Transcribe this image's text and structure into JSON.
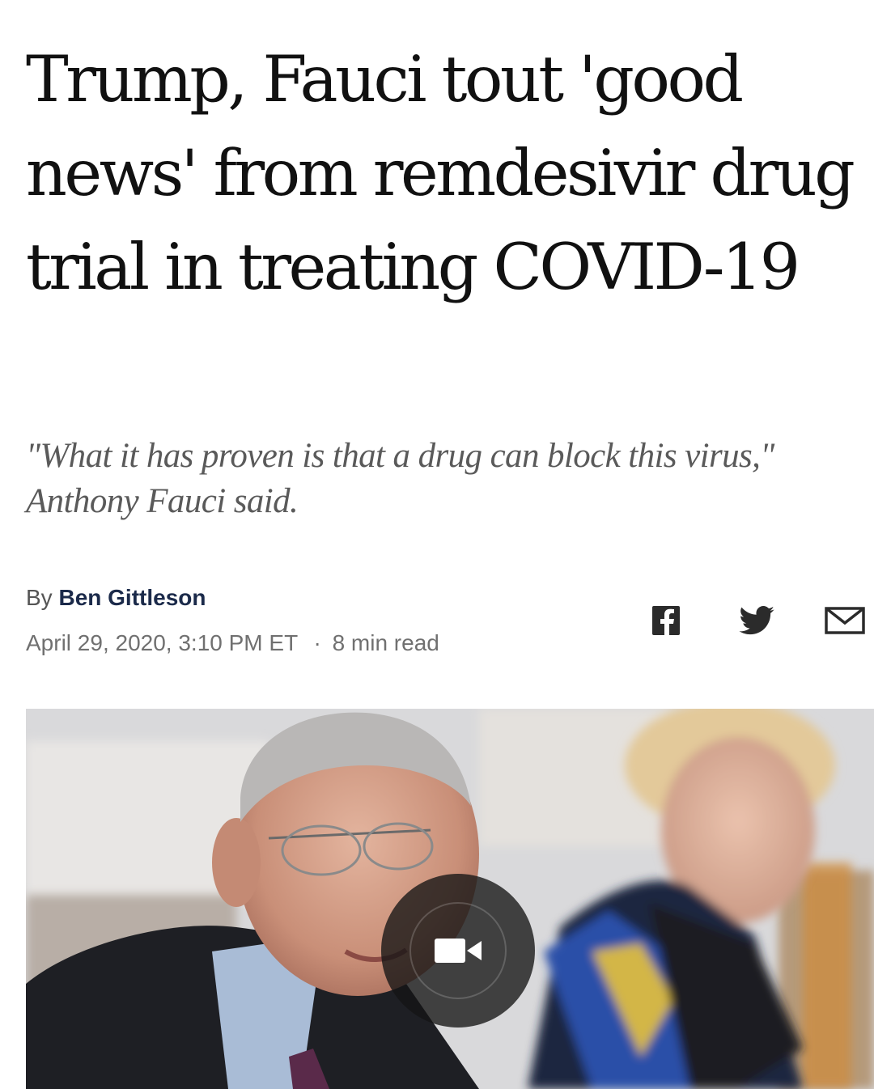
{
  "article": {
    "headline": "Trump, Fauci tout 'good news' from remdesivir drug trial in treating COVID-19",
    "dek": "\"What it has proven is that a drug can block this virus,\" Anthony Fauci said.",
    "byline": {
      "prefix": "By",
      "author": "Ben Gittleson"
    },
    "date": "April 29, 2020, 3:10 PM ET",
    "separator": "·",
    "read_time": "8 min read"
  },
  "share": {
    "facebook_icon": "facebook-icon",
    "twitter_icon": "twitter-icon",
    "email_icon": "email-icon",
    "icon_color": "#2b2b2b"
  },
  "hero": {
    "media_type": "video",
    "play_icon": "video-camera-icon"
  },
  "colors": {
    "headline": "#111111",
    "dek": "#5a5a5a",
    "author": "#1b2a4a",
    "meta": "#707070"
  }
}
